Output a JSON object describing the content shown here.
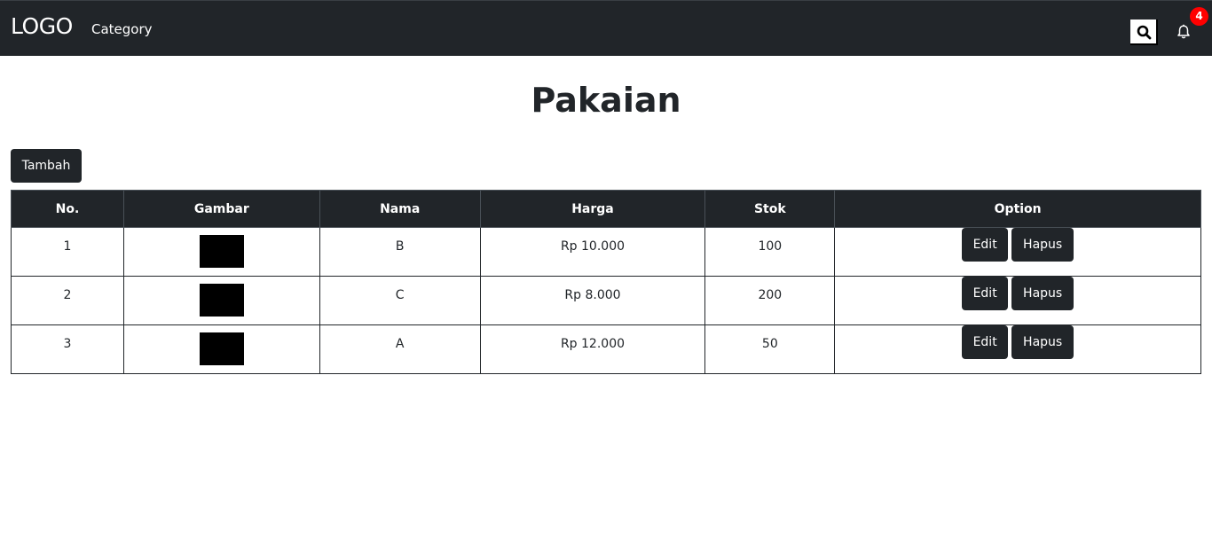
{
  "navbar": {
    "logo": "LOGO",
    "category_link": "Category",
    "notification_count": "4",
    "background": "#212529",
    "badge_color": "#ff0000"
  },
  "page": {
    "title": "Pakaian",
    "add_button": "Tambah"
  },
  "table": {
    "headers": [
      "No.",
      "Gambar",
      "Nama",
      "Harga",
      "Stok",
      "Option"
    ],
    "rows": [
      {
        "no": "1",
        "nama": "B",
        "harga": "Rp 10.000",
        "stok": "100"
      },
      {
        "no": "2",
        "nama": "C",
        "harga": "Rp 8.000",
        "stok": "200"
      },
      {
        "no": "3",
        "nama": "A",
        "harga": "Rp 12.000",
        "stok": "50"
      }
    ],
    "edit_label": "Edit",
    "delete_label": "Hapus"
  }
}
